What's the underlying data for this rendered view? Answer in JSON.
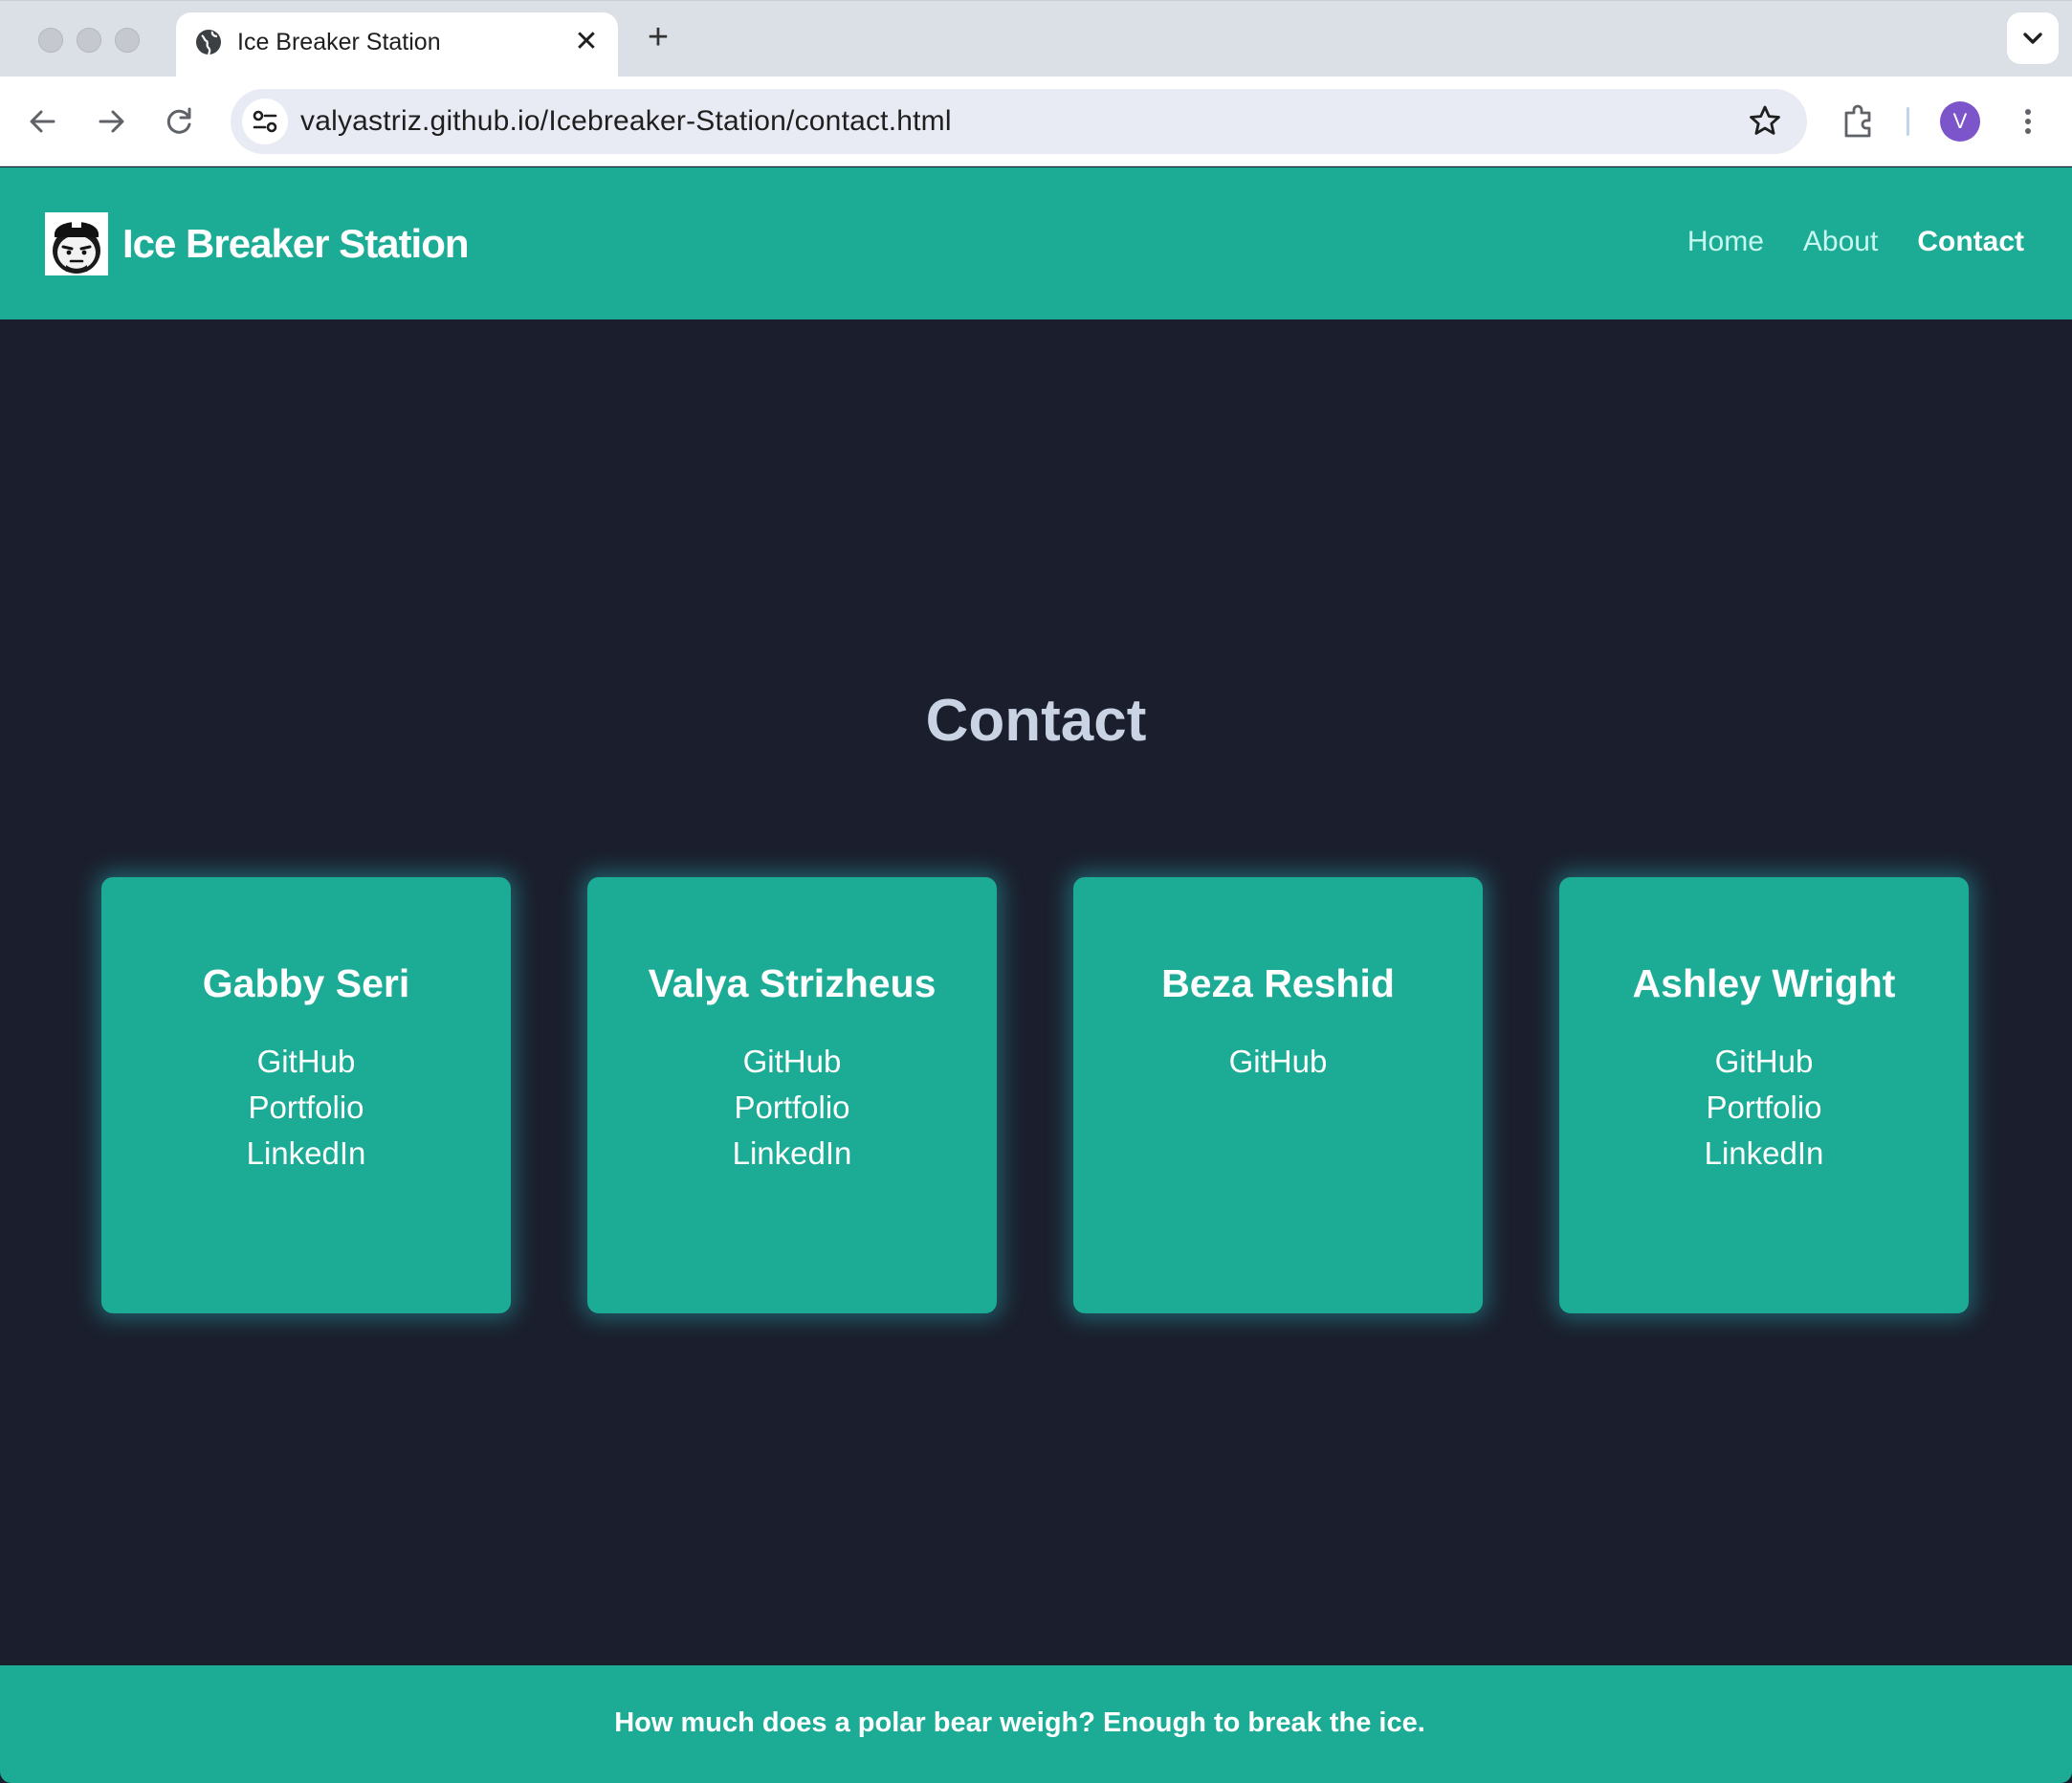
{
  "browser": {
    "tab_title": "Ice Breaker Station",
    "url_host": "valyastriz.github.io",
    "url_path": "/Icebreaker-Station/contact.html",
    "profile_initial": "V",
    "icons": [
      "globe-icon",
      "close-icon",
      "plus-icon",
      "chevron-down-icon",
      "back-arrow-icon",
      "forward-arrow-icon",
      "reload-icon",
      "site-settings-icon",
      "bookmark-star-icon",
      "extensions-puzzle-icon",
      "more-vertical-icon"
    ]
  },
  "header": {
    "brand": "Ice Breaker Station",
    "nav": [
      {
        "label": "Home",
        "active": false
      },
      {
        "label": "About",
        "active": false
      },
      {
        "label": "Contact",
        "active": true
      }
    ]
  },
  "main": {
    "heading": "Contact",
    "cards": [
      {
        "name": "Gabby Seri",
        "links": [
          "GitHub",
          "Portfolio",
          "LinkedIn"
        ]
      },
      {
        "name": "Valya Strizheus",
        "links": [
          "GitHub",
          "Portfolio",
          "LinkedIn"
        ]
      },
      {
        "name": "Beza Reshid",
        "links": [
          "GitHub"
        ]
      },
      {
        "name": "Ashley Wright",
        "links": [
          "GitHub",
          "Portfolio",
          "LinkedIn"
        ]
      }
    ]
  },
  "footer": {
    "text": "How much does a polar bear weigh? Enough to break the ice."
  },
  "colors": {
    "brand_teal": "#1cac96",
    "page_background": "#1b1f2d",
    "heading": "#c9d3e3",
    "card_glow": "#28c8cd"
  }
}
